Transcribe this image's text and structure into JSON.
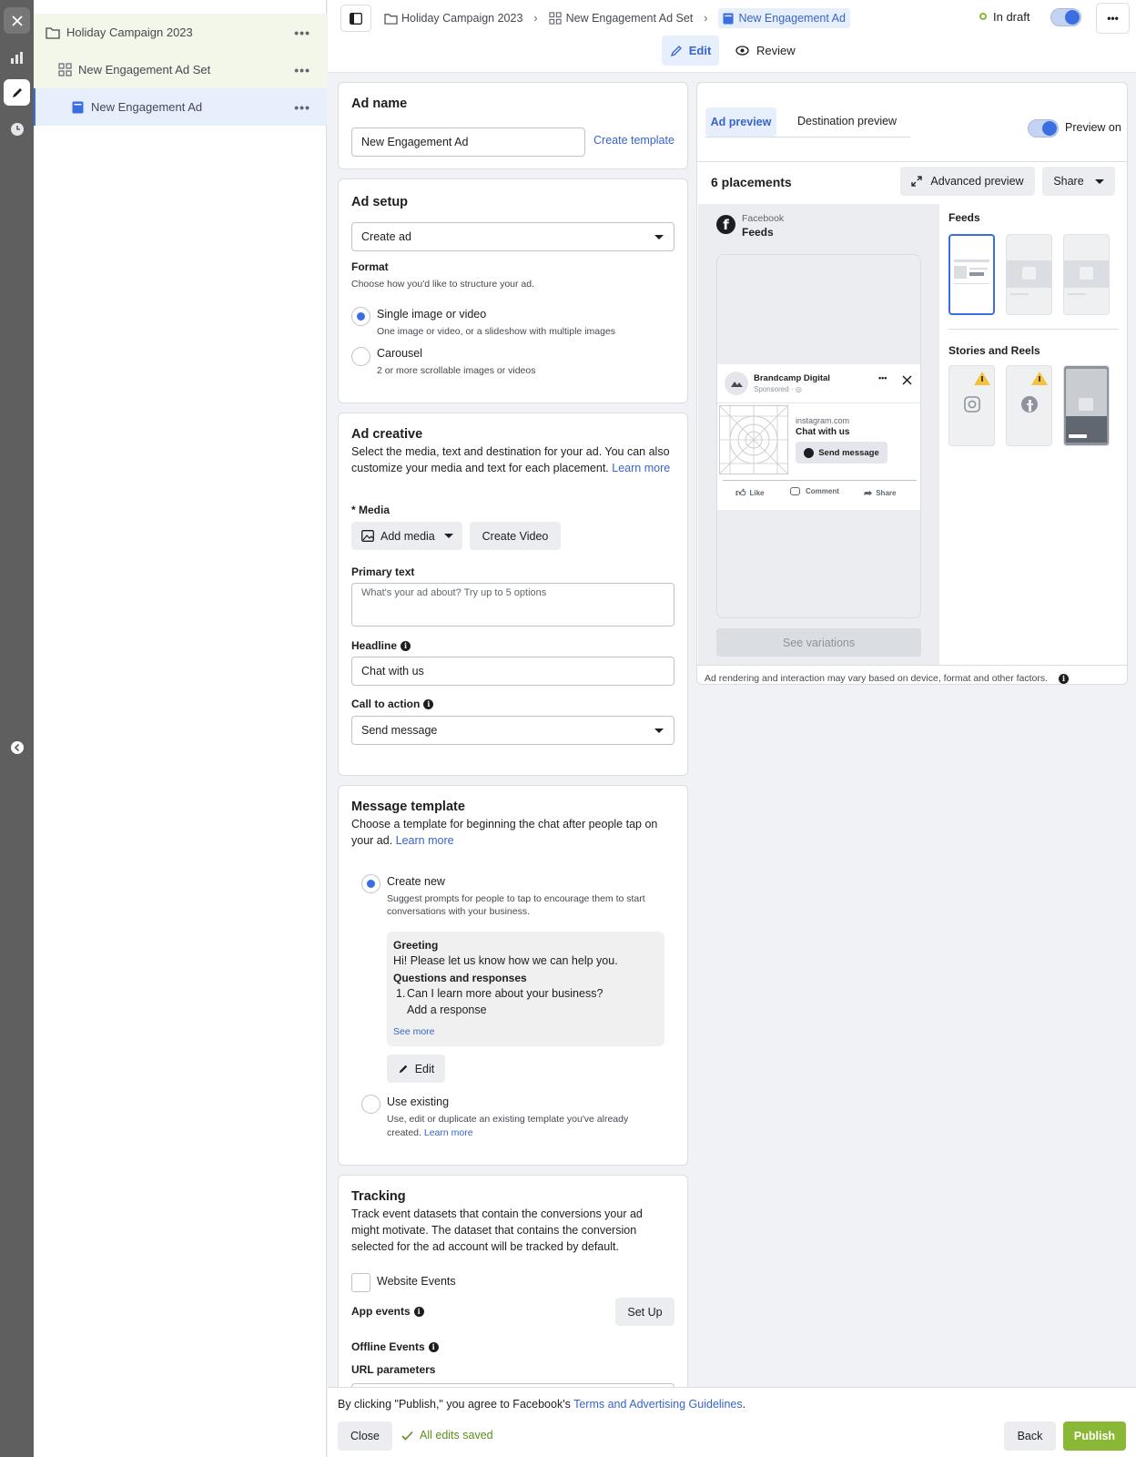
{
  "tree": {
    "campaign": "Holiday Campaign 2023",
    "adset": "New Engagement Ad Set",
    "ad": "New Engagement Ad",
    "more": "•••"
  },
  "topbar": {
    "breadcrumb": [
      "Holiday Campaign 2023",
      "New Engagement Ad Set",
      "New Engagement Ad"
    ],
    "status": "In draft",
    "more": "•••",
    "edit_tab": "Edit",
    "review_tab": "Review"
  },
  "ad_name": {
    "title": "Ad name",
    "value": "New Engagement Ad",
    "create_template": "Create template"
  },
  "ad_setup": {
    "title": "Ad setup",
    "select": "Create ad",
    "format_label": "Format",
    "format_help": "Choose how you'd like to structure your ad.",
    "single_label": "Single image or video",
    "single_desc": "One image or video, or a slideshow with multiple images",
    "carousel_label": "Carousel",
    "carousel_desc": "2 or more scrollable images or videos"
  },
  "ad_creative": {
    "title": "Ad creative",
    "desc_line1": "Select the media, text and destination for your ad. You can also",
    "desc_line2": "customize your media and text for each placement.",
    "learn_more": "Learn more",
    "media_label": "* Media",
    "add_media": "Add media",
    "create_video": "Create Video",
    "primary_label": "Primary text",
    "primary_placeholder": "What's your ad about? Try up to 5 options",
    "headline_label": "Headline",
    "headline_value": "Chat with us",
    "cta_label": "Call to action",
    "cta_value": "Send message"
  },
  "message_template": {
    "title": "Message template",
    "desc_line1": "Choose a template for beginning the chat after people tap on",
    "desc_line2": "your ad.",
    "learn_more": "Learn more",
    "create_new": "Create new",
    "create_new_desc1": "Suggest prompts for people to tap to encourage them to start",
    "create_new_desc2": "conversations with your business.",
    "greeting_label": "Greeting",
    "greeting_text": "Hi! Please let us know how we can help you.",
    "qa_label": "Questions and responses",
    "question_num": "1.",
    "question": "Can I learn more about your business?",
    "response": "Add a response",
    "see_more": "See more",
    "edit": "Edit",
    "use_existing": "Use existing",
    "use_existing_desc1": "Use, edit or duplicate an existing template you've already",
    "use_existing_desc2": "created.",
    "use_existing_learn": "Learn more"
  },
  "tracking": {
    "title": "Tracking",
    "desc_line1": "Track event datasets that contain the conversions your ad",
    "desc_line2": "might motivate. The dataset that contains the conversion",
    "desc_line3": "selected for the ad account will be tracked by default.",
    "website_events": "Website Events",
    "app_events": "App events",
    "set_up": "Set Up",
    "offline_events": "Offline Events",
    "url_parameters": "URL parameters"
  },
  "preview": {
    "tab_ad": "Ad preview",
    "tab_dest": "Destination preview",
    "preview_on": "Preview on",
    "placements": "6 placements",
    "advanced": "Advanced preview",
    "share": "Share",
    "platform": "Facebook",
    "placement": "Feeds",
    "page_name": "Brandcamp Digital",
    "sponsored": "Sponsored · ",
    "domain": "instagram.com",
    "headline": "Chat with us",
    "cta": "Send message",
    "like": "Like",
    "comment": "Comment",
    "share_action": "Share",
    "see_variations": "See variations",
    "feeds_heading": "Feeds",
    "stories_heading": "Stories and Reels",
    "disclaimer": "Ad rendering and interaction may vary based on device, format and other factors."
  },
  "footer": {
    "agree_text": "By clicking \"Publish,\" you agree to Facebook's ",
    "terms_link": "Terms and Advertising Guidelines",
    "period": ".",
    "close": "Close",
    "saved": "All edits saved",
    "back": "Back",
    "publish": "Publish"
  },
  "colors": {
    "accent": "#3b6ee0",
    "publish": "#8ab836",
    "selected_row": "#e7effd",
    "tree_top": "#f2f7ea"
  }
}
